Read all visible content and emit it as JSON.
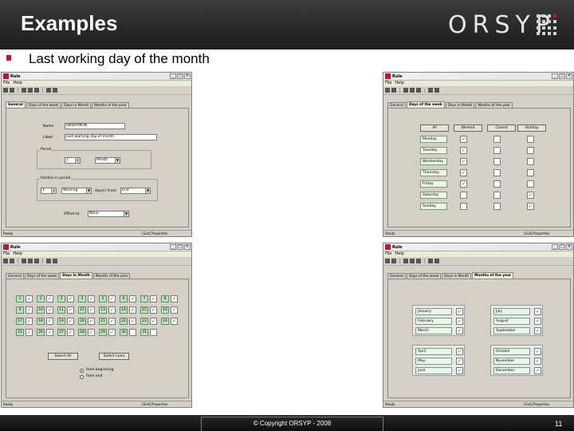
{
  "slide": {
    "title": "Examples",
    "logo_text": "ORSYP",
    "subtitle": "Last working day of the month",
    "copyright": "© Copyright ORSYP - 2008",
    "page_number": "11",
    "colors": {
      "accent": "#c8102e",
      "header": "#2a2a2a"
    }
  },
  "window": {
    "title": "Rule",
    "menu": [
      "File",
      "Help"
    ],
    "tabs": [
      "General",
      "Days of the week",
      "Days in Month",
      "Months of the year"
    ],
    "status_ready": "Ready",
    "status_exit": "Exit",
    "status_mode": "Properties"
  },
  "general": {
    "name_label": "Name",
    "name_value": "LWDAYMON",
    "label_label": "Label",
    "label_value": "Last working day of month",
    "period_label": "Period",
    "period_count": "1",
    "period_unit": "Month",
    "position_label": "Position in period",
    "position_count": "1",
    "position_type": "Working",
    "position_day_label": "day(s)",
    "position_from_label": "From",
    "position_from_value": "End",
    "offset_label": "Offset to",
    "offset_value": "None"
  },
  "days_of_week": {
    "headers": [
      "All",
      "Worked",
      "Closed",
      "Holiday"
    ],
    "days": [
      "Monday",
      "Tuesday",
      "Wednesday",
      "Thursday",
      "Friday",
      "Saturday",
      "Sunday"
    ]
  },
  "days_in_month": {
    "numbers": [
      1,
      2,
      3,
      4,
      5,
      6,
      7,
      8,
      9,
      10,
      11,
      12,
      13,
      14,
      15,
      16,
      17,
      18,
      19,
      20,
      21,
      22,
      23,
      24,
      25,
      26,
      27,
      28,
      29,
      30,
      31
    ],
    "select_all": "Select All",
    "select_none": "Select none",
    "from_beginning": "from beginning",
    "from_end": "from end"
  },
  "months": {
    "groups": [
      [
        "January",
        "February",
        "March"
      ],
      [
        "July",
        "August",
        "September"
      ],
      [
        "April",
        "May",
        "June"
      ],
      [
        "October",
        "November",
        "December"
      ]
    ]
  }
}
